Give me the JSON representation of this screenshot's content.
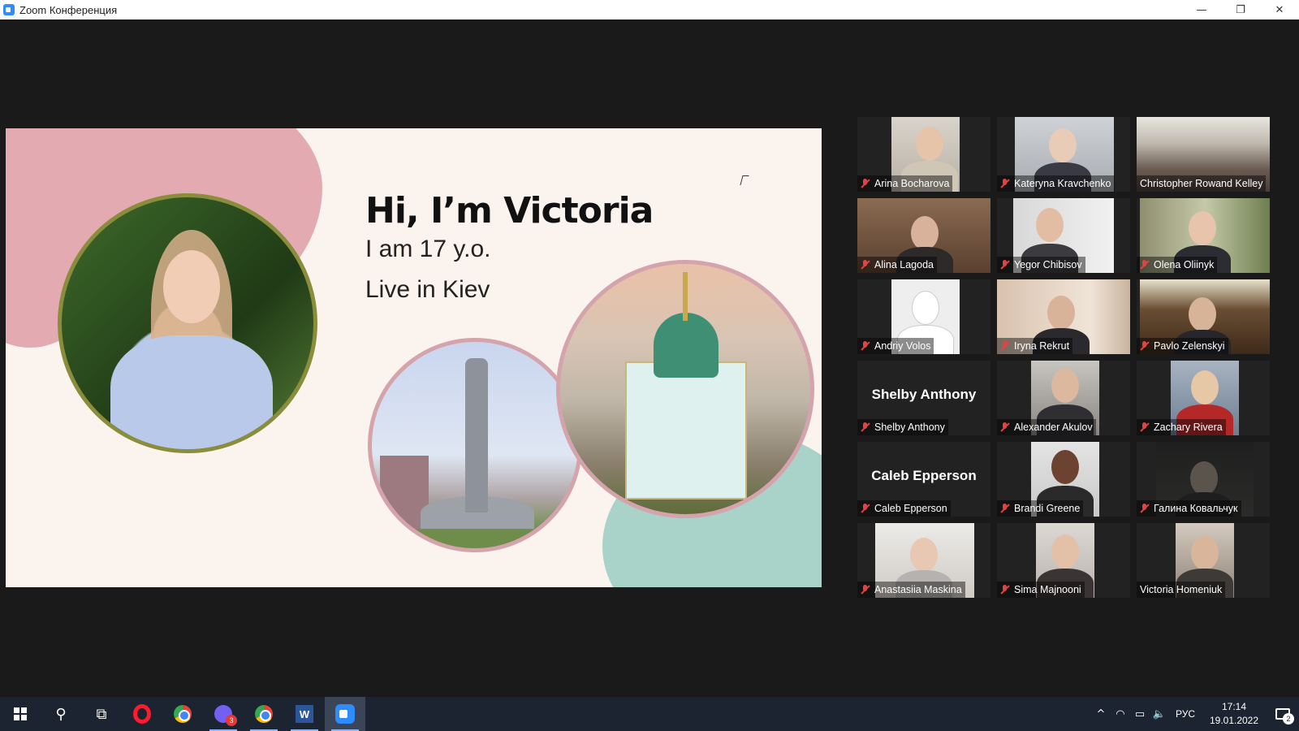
{
  "window": {
    "title": "Zoom Конференция",
    "minimize": "—",
    "restore": "❐",
    "close": "✕"
  },
  "slide": {
    "title": "Hi, I’m Victoria",
    "line1": "I am 17 y.o.",
    "line2": "Live in Kiev"
  },
  "participants": [
    {
      "name": "Arina Bocharova",
      "muted": true
    },
    {
      "name": "Kateryna Kravchenko",
      "muted": true
    },
    {
      "name": "Christopher Rowand Kelley",
      "muted": false,
      "active_speaker": true
    },
    {
      "name": "Alina Lagoda",
      "muted": true
    },
    {
      "name": "Yegor Chibisov",
      "muted": true
    },
    {
      "name": "Olena Oliinyk",
      "muted": true
    },
    {
      "name": "Andriy Volos",
      "muted": true
    },
    {
      "name": "Iryna Rekrut",
      "muted": true
    },
    {
      "name": "Pavlo Zelenskyi",
      "muted": true
    },
    {
      "name": "Shelby Anthony",
      "muted": true,
      "video_off": true,
      "display_name": "Shelby Anthony"
    },
    {
      "name": "Alexander Akulov",
      "muted": true
    },
    {
      "name": "Zachary Rivera",
      "muted": true
    },
    {
      "name": "Caleb Epperson",
      "muted": true,
      "video_off": true,
      "display_name": "Caleb Epperson"
    },
    {
      "name": "Brandi Greene",
      "muted": true
    },
    {
      "name": "Галина Ковальчук",
      "muted": true
    },
    {
      "name": "Anastasiia Maskina",
      "muted": true
    },
    {
      "name": "Sima Majnooni",
      "muted": true
    },
    {
      "name": "Victoria Homeniuk",
      "muted": false
    }
  ],
  "taskbar": {
    "viber_badge": "3",
    "word_label": "W",
    "tray_language": "РУС",
    "time": "17:14",
    "date": "19.01.2022",
    "notification_count": "2",
    "tray_icons": [
      "^",
      "wifi-icon",
      "battery-icon",
      "speaker-icon"
    ]
  }
}
